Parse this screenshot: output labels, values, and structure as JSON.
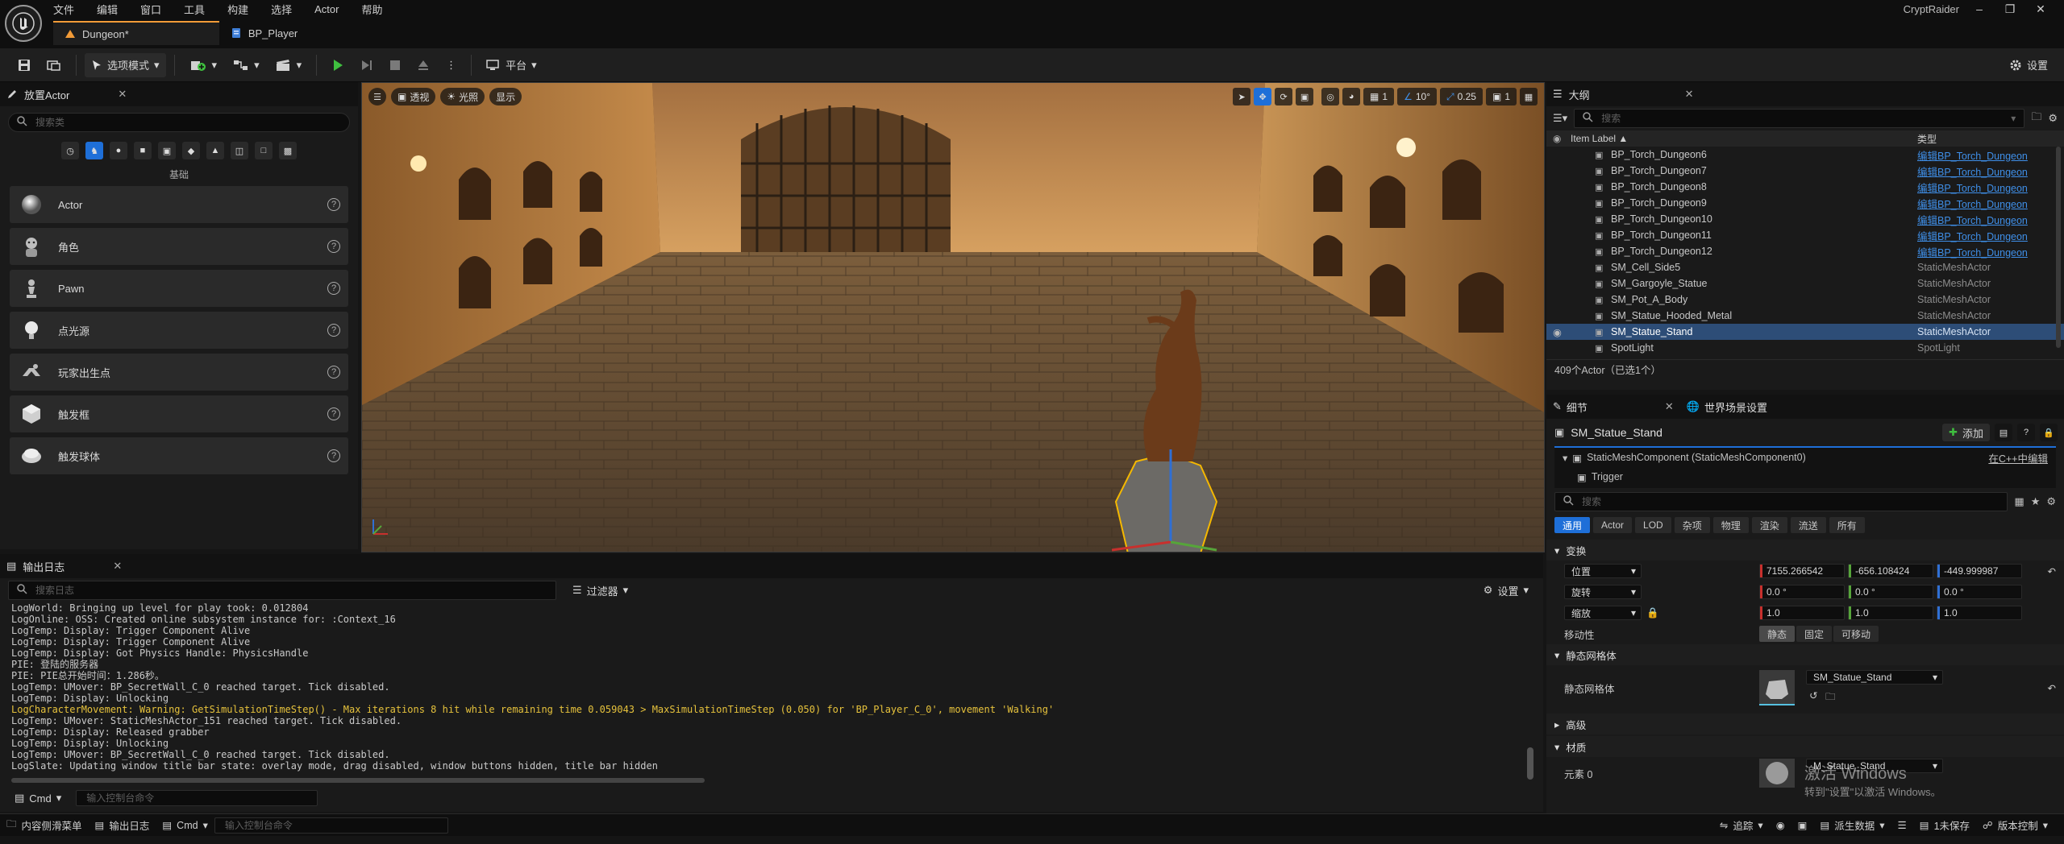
{
  "app": {
    "project": "CryptRaider"
  },
  "menu": [
    "文件",
    "编辑",
    "窗口",
    "工具",
    "构建",
    "选择",
    "Actor",
    "帮助"
  ],
  "doc_tabs": [
    {
      "label": "Dungeon*"
    },
    {
      "label": "BP_Player"
    }
  ],
  "toolbar": {
    "select_mode": "选项模式",
    "platform": "平台",
    "settings": "设置"
  },
  "place_actors": {
    "title": "放置Actor",
    "search_placeholder": "搜索类",
    "category": "基础",
    "items": [
      {
        "label": "Actor",
        "icon": "sphere-icon"
      },
      {
        "label": "角色",
        "icon": "character-icon"
      },
      {
        "label": "Pawn",
        "icon": "pawn-icon"
      },
      {
        "label": "点光源",
        "icon": "point-light-icon"
      },
      {
        "label": "玩家出生点",
        "icon": "player-start-icon"
      },
      {
        "label": "触发框",
        "icon": "trigger-box-icon"
      },
      {
        "label": "触发球体",
        "icon": "trigger-sphere-icon"
      }
    ]
  },
  "viewport": {
    "perspective": "透视",
    "lighting": "光照",
    "show": "显示",
    "grid_snap": "1",
    "angle_snap": "10°",
    "scale_snap": "0.25",
    "camera_speed": "1"
  },
  "outliner": {
    "title": "大纲",
    "search_placeholder": "搜索",
    "col_label": "Item Label ▲",
    "col_type": "类型",
    "rows": [
      {
        "label": "BP_Torch_Dungeon6",
        "type": "编辑BP_Torch_Dungeon",
        "link": true,
        "selected": false
      },
      {
        "label": "BP_Torch_Dungeon7",
        "type": "编辑BP_Torch_Dungeon",
        "link": true,
        "selected": false
      },
      {
        "label": "BP_Torch_Dungeon8",
        "type": "编辑BP_Torch_Dungeon",
        "link": true,
        "selected": false
      },
      {
        "label": "BP_Torch_Dungeon9",
        "type": "编辑BP_Torch_Dungeon",
        "link": true,
        "selected": false
      },
      {
        "label": "BP_Torch_Dungeon10",
        "type": "编辑BP_Torch_Dungeon",
        "link": true,
        "selected": false
      },
      {
        "label": "BP_Torch_Dungeon11",
        "type": "编辑BP_Torch_Dungeon",
        "link": true,
        "selected": false
      },
      {
        "label": "BP_Torch_Dungeon12",
        "type": "编辑BP_Torch_Dungeon",
        "link": true,
        "selected": false
      },
      {
        "label": "SM_Cell_Side5",
        "type": "StaticMeshActor",
        "link": false,
        "selected": false
      },
      {
        "label": "SM_Gargoyle_Statue",
        "type": "StaticMeshActor",
        "link": false,
        "selected": false
      },
      {
        "label": "SM_Pot_A_Body",
        "type": "StaticMeshActor",
        "link": false,
        "selected": false
      },
      {
        "label": "SM_Statue_Hooded_Metal",
        "type": "StaticMeshActor",
        "link": false,
        "selected": false
      },
      {
        "label": "SM_Statue_Stand",
        "type": "StaticMeshActor",
        "link": false,
        "selected": true
      },
      {
        "label": "SpotLight",
        "type": "SpotLight",
        "link": false,
        "selected": false
      }
    ],
    "footer": "409个Actor（已选1个）"
  },
  "details": {
    "tab_details": "细节",
    "tab_world": "世界场景设置",
    "object_name": "SM_Statue_Stand",
    "add_button": "添加",
    "component": "StaticMeshComponent (StaticMeshComponent0)",
    "edit_cpp": "在C++中编辑",
    "child": "Trigger",
    "search_placeholder": "搜索",
    "filters": [
      "通用",
      "Actor",
      "LOD",
      "杂项",
      "物理",
      "渲染",
      "流送",
      "所有"
    ],
    "transform_section": "变换",
    "location_label": "位置",
    "location": [
      "7155.266542",
      "-656.108424",
      "-449.999987"
    ],
    "rotation_label": "旋转",
    "rotation": [
      "0.0 °",
      "0.0 °",
      "0.0 °"
    ],
    "scale_label": "缩放",
    "scale": [
      "1.0",
      "1.0",
      "1.0"
    ],
    "mobility_label": "移动性",
    "mobility": [
      "静态",
      "固定",
      "可移动"
    ],
    "static_mesh_section": "静态网格体",
    "static_mesh_label": "静态网格体",
    "static_mesh_value": "SM_Statue_Stand",
    "advanced_section": "高级",
    "materials_section": "材质",
    "element0_label": "元素 0",
    "element0_value": "M_Statue_Stand",
    "watermark_title": "激活 Windows",
    "watermark_sub": "转到\"设置\"以激活 Windows。"
  },
  "output_log": {
    "title": "输出日志",
    "search_placeholder": "搜索日志",
    "filter": "过滤器",
    "settings": "设置",
    "cmd": "Cmd",
    "cmd_placeholder": "输入控制台命令",
    "lines": [
      {
        "text": "LogWorld: Bringing up level for play took: 0.012804",
        "warn": false
      },
      {
        "text": "LogOnline: OSS: Created online subsystem instance for: :Context_16",
        "warn": false
      },
      {
        "text": "LogTemp: Display: Trigger Component Alive",
        "warn": false
      },
      {
        "text": "LogTemp: Display: Trigger Component Alive",
        "warn": false
      },
      {
        "text": "LogTemp: Display: Got Physics Handle: PhysicsHandle",
        "warn": false
      },
      {
        "text": "PIE: 登陆的服务器",
        "warn": false
      },
      {
        "text": "PIE: PIE总开始时间：1.286秒。",
        "warn": false
      },
      {
        "text": "LogTemp: UMover: BP_SecretWall_C_0 reached target. Tick disabled.",
        "warn": false
      },
      {
        "text": "LogTemp: Display: Unlocking",
        "warn": false
      },
      {
        "text": "LogCharacterMovement: Warning: GetSimulationTimeStep() - Max iterations 8 hit while remaining time 0.059043 > MaxSimulationTimeStep (0.050) for 'BP_Player_C_0', movement 'Walking'",
        "warn": true
      },
      {
        "text": "LogTemp: UMover: StaticMeshActor_151 reached target. Tick disabled.",
        "warn": false
      },
      {
        "text": "LogTemp: Display: Released grabber",
        "warn": false
      },
      {
        "text": "LogTemp: Display: Unlocking",
        "warn": false
      },
      {
        "text": "LogTemp: UMover: BP_SecretWall_C_0 reached target. Tick disabled.",
        "warn": false
      },
      {
        "text": "LogSlate: Updating window title bar state: overlay mode, drag disabled, window buttons hidden, title bar hidden",
        "warn": false
      }
    ]
  },
  "bottom_bar": {
    "content_drawer": "内容侧滑菜单",
    "output_log": "输出日志",
    "cmd": "Cmd",
    "cmd_placeholder": "输入控制台命令",
    "trace": "追踪",
    "derived_data": "派生数据",
    "unsaved": "1未保存",
    "source_control": "版本控制"
  },
  "colors": {
    "accent": "#f29b38",
    "selection": "#2d4d77",
    "link": "#3f8fe8",
    "play": "#3fbf3f",
    "warning": "#e6c23c"
  }
}
